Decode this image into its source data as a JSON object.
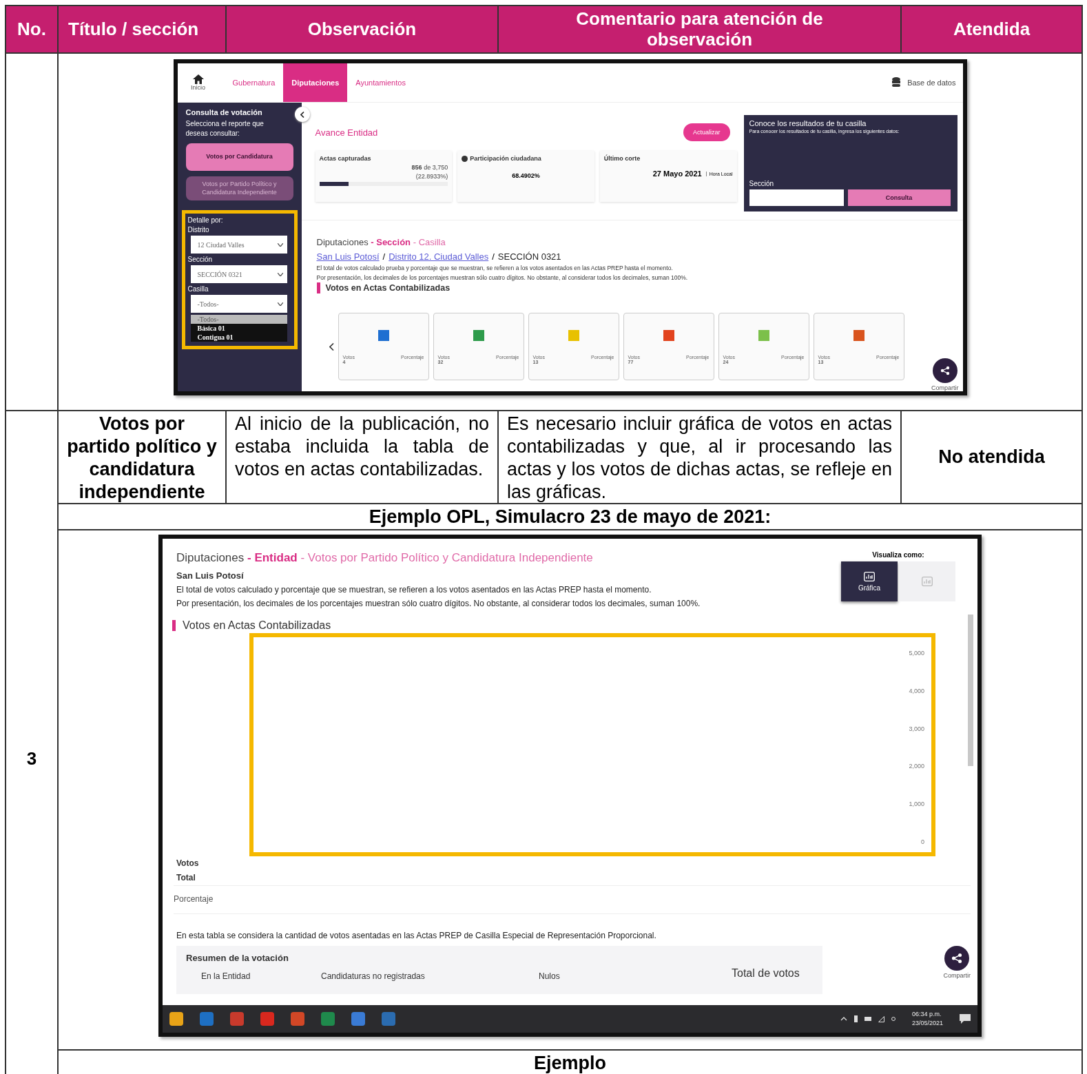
{
  "table": {
    "columns": [
      "No.",
      "Título / sección",
      "Observación",
      "Comentario para atención de observación",
      "Atendida"
    ],
    "rows": [
      {
        "no": "3",
        "title": "Votos por partido político y candidatura independiente",
        "observation": "Al inicio de la publicación, no estaba incluida la tabla de votos en actas contabilizadas.",
        "comment": "Es necesario incluir gráfica de votos en actas contabilizadas y que, al ir procesando las actas y los votos de dichas actas, se refleje en las gráficas.",
        "status": "No atendida"
      }
    ],
    "example_caption": "Ejemplo OPL, Simulacro 23 de mayo de 2021:",
    "next_caption": "Ejemplo"
  },
  "screenshot_1": {
    "nav": {
      "home_label": "Inicio",
      "tabs": [
        {
          "label": "Gubernatura",
          "selected": false
        },
        {
          "label": "Diputaciones",
          "selected": true
        },
        {
          "label": "Ayuntamientos",
          "selected": false
        }
      ],
      "database_link": "Base de datos"
    },
    "sidebar": {
      "title": "Consulta de votación",
      "subtitle": "Selecciona el reporte que deseas consultar:",
      "reports": [
        {
          "label": "Votos por Candidatura",
          "selected": true
        },
        {
          "label": "Votos por Partido Político y Candidatura Independiente",
          "selected": false
        }
      ],
      "detail_title": "Detalle por:",
      "filters": [
        {
          "label": "Distrito",
          "value": "12 Ciudad Valles"
        },
        {
          "label": "Sección",
          "value": "SECCIÓN 0321"
        },
        {
          "label": "Casilla",
          "value": "-Todos-"
        }
      ],
      "dropdown_options": [
        {
          "label": "-Todos-",
          "selected": true
        },
        {
          "label": "Básica 01",
          "selected": false
        },
        {
          "label": "Contigua 01",
          "selected": false
        }
      ]
    },
    "progress": {
      "title": "Avance Entidad",
      "refresh_button": "Actualizar",
      "actas_label": "Actas capturadas",
      "actas_count": "856",
      "actas_of": "de 3,750",
      "actas_percent": "(22.8933%)",
      "level": 0.23,
      "participation_label": "Participación ciudadana",
      "participation_value": "68.4902%",
      "cut_label": "Último corte",
      "cut_date": "27 Mayo 2021",
      "cut_time_label": "Hora Local"
    },
    "lookup": {
      "title": "Conoce los resultados de tu casilla",
      "hint": "Para conocer los resultados de tu casilla, ingresa los siguientes datos:",
      "field_label": "Sección",
      "button": "Consulta"
    },
    "breadcrumb": [
      {
        "text": "Diputaciones",
        "kind": "plain"
      },
      {
        "text": " - Sección",
        "kind": "strong"
      },
      {
        "text": " - Casilla",
        "kind": "accent"
      }
    ],
    "path": [
      {
        "text": "San Luis Potosí",
        "kind": "link"
      },
      {
        "text": "/",
        "kind": "separator"
      },
      {
        "text": "Distrito 12. Ciudad Valles",
        "kind": "link"
      },
      {
        "text": "/",
        "kind": "separator"
      },
      {
        "text": "SECCIÓN 0321",
        "kind": "current"
      }
    ],
    "notes": [
      "El total de votos calculado prueba y porcentaje que se muestran, se refieren a los votos asentados en las Actas PREP hasta el momento.",
      "Por presentación, los decimales de los porcentajes muestran sólo cuatro dígitos. No obstante, al considerar todos los decimales, suman 100%."
    ],
    "heading": "Votos en Actas Contabilizadas",
    "cards": [
      {
        "color": "#1f6fd1",
        "votes_label": "Votos",
        "votes": "4",
        "percent_label": "Porcentaje"
      },
      {
        "color": "#2e9b4b",
        "votes_label": "Votos",
        "votes": "32",
        "percent_label": "Porcentaje"
      },
      {
        "color": "#e8c100",
        "votes_label": "Votos",
        "votes": "13",
        "percent_label": "Porcentaje"
      },
      {
        "color": "#e2431e",
        "votes_label": "Votos",
        "votes": "77",
        "percent_label": "Porcentaje"
      },
      {
        "color": "#7cc04a",
        "votes_label": "Votos",
        "votes": "24",
        "percent_label": "Porcentaje"
      },
      {
        "color": "#d9541e",
        "votes_label": "Votos",
        "votes": "13",
        "percent_label": "Porcentaje"
      }
    ],
    "share": "Compartir"
  },
  "screenshot_2": {
    "breadcrumb": [
      {
        "text": "Diputaciones",
        "kind": "plain"
      },
      {
        "text": " - Entidad",
        "kind": "strong"
      },
      {
        "text": " - Votos por Partido Político y Candidatura Independiente",
        "kind": "accent"
      }
    ],
    "place": "San Luis Potosí",
    "notes": [
      "El total de votos calculado y porcentaje que se muestran, se refieren a los votos asentados en las Actas PREP hasta el momento.",
      "Por presentación, los decimales de los porcentajes muestran sólo cuatro dígitos. No obstante, al considerar todos los decimales, suman 100%."
    ],
    "view_label": "Visualiza como:",
    "view_options": [
      {
        "label": "Gráfica",
        "selected": true
      },
      {
        "selected": false
      }
    ],
    "heading": "Votos en Actas Contabilizadas",
    "y_tick_labels": [
      "5,000",
      "4,000",
      "3,000",
      "2,000",
      "1,000",
      "0"
    ],
    "row_labels": [
      "Votos",
      "Total"
    ],
    "percent_label": "Porcentaje",
    "footnote": "En esta tabla se considera la cantidad de votos asentadas en las Actas PREP de Casilla Especial de Representación Proporcional.",
    "summary": {
      "title": "Resumen de la votación",
      "columns": [
        "En la Entidad",
        "Candidaturas no registradas",
        "Nulos"
      ],
      "total_label": "Total de votos"
    },
    "share": "Compartir",
    "taskbar": {
      "apps": [
        {
          "color": "#e8a317"
        },
        {
          "color": "#1e6fc2"
        },
        {
          "color": "#c83a2c"
        },
        {
          "color": "#d9281e"
        },
        {
          "color": "#d24726"
        },
        {
          "color": "#1f8a4c"
        },
        {
          "color": "#3a7bd5"
        },
        {
          "color": "#2b6cb0"
        }
      ],
      "time": "06:34 p.m.",
      "date": "23/05/2021"
    }
  }
}
